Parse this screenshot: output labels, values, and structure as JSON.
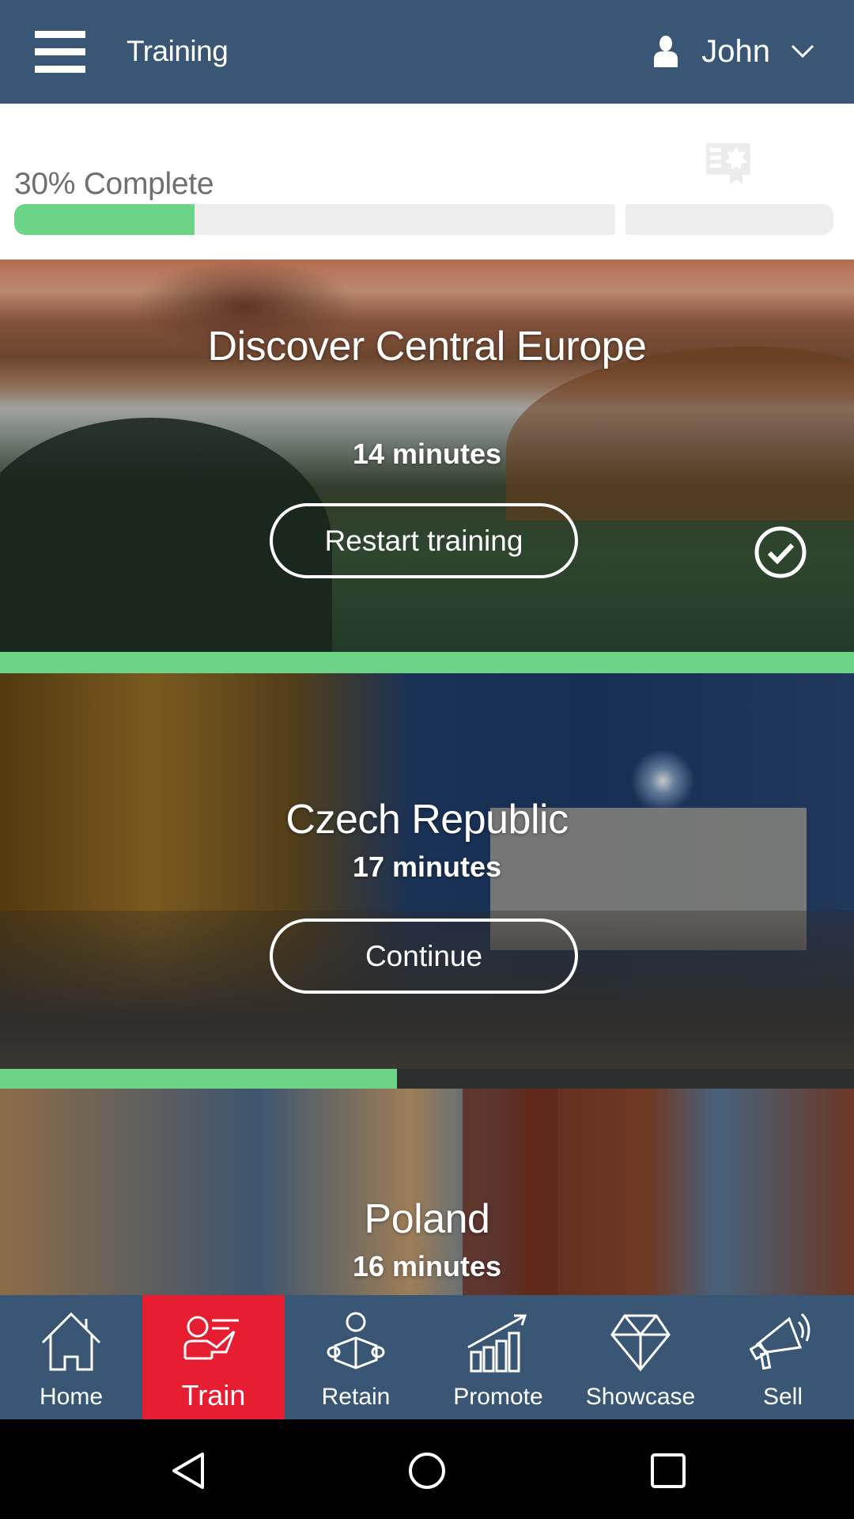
{
  "header": {
    "title": "Training",
    "menu_icon": "hamburger-menu-icon",
    "user": {
      "name": "John",
      "icon": "user-icon",
      "dropdown_icon": "chevron-down-icon"
    }
  },
  "progress": {
    "label": "30% Complete",
    "percent": 30,
    "segments": [
      {
        "name": "trainings",
        "fill_percent": 30
      },
      {
        "name": "certificate",
        "fill_percent": 0
      }
    ],
    "certificate_icon": "certificate-icon"
  },
  "courses": [
    {
      "title": "Discover Central Europe",
      "duration": "14 minutes",
      "button": "Restart training",
      "completed": true,
      "progress_percent": 100
    },
    {
      "title": "Czech Republic",
      "duration": "17 minutes",
      "button": "Continue",
      "completed": false,
      "progress_percent": 46.5
    },
    {
      "title": "Poland",
      "duration": "16 minutes",
      "completed": false
    }
  ],
  "colors": {
    "header_bg": "#395674",
    "active_tab": "#e71d32",
    "progress_green": "#6cd487",
    "progress_track": "#eeeeee"
  },
  "bottom_nav": [
    {
      "label": "Home",
      "icon": "home-icon",
      "active": false
    },
    {
      "label": "Train",
      "icon": "trainer-icon",
      "active": true
    },
    {
      "label": "Retain",
      "icon": "reader-icon",
      "active": false
    },
    {
      "label": "Promote",
      "icon": "growth-chart-icon",
      "active": false
    },
    {
      "label": "Showcase",
      "icon": "diamond-icon",
      "active": false
    },
    {
      "label": "Sell",
      "icon": "megaphone-icon",
      "active": false
    }
  ],
  "system_nav": [
    "back",
    "home",
    "recents"
  ]
}
